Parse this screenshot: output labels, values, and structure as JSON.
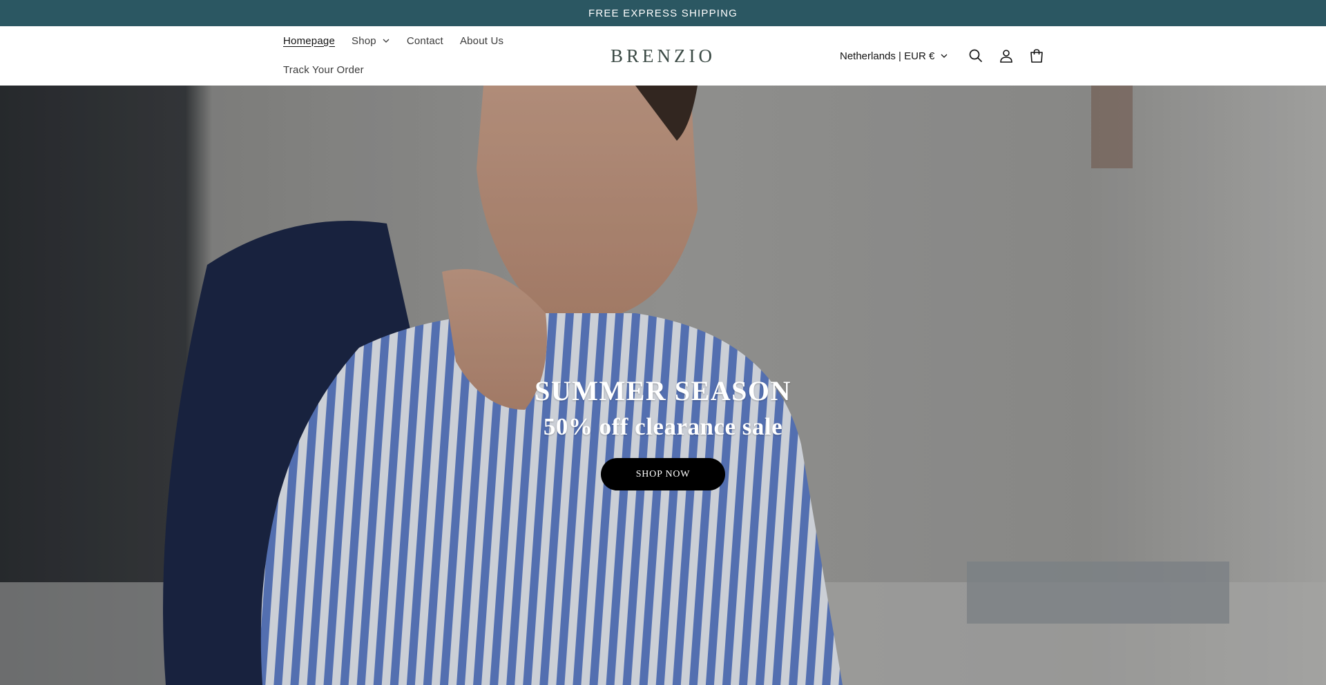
{
  "announcement": {
    "text": "FREE EXPRESS SHIPPING"
  },
  "nav": {
    "items": [
      {
        "label": "Homepage",
        "active": true
      },
      {
        "label": "Shop",
        "has_dropdown": true
      },
      {
        "label": "Contact"
      },
      {
        "label": "About Us"
      },
      {
        "label": "Track Your Order"
      }
    ]
  },
  "logo": {
    "text": "BRENZIO"
  },
  "localization": {
    "label": "Netherlands | EUR €"
  },
  "header_icons": [
    "search-icon",
    "account-icon",
    "cart-icon"
  ],
  "hero": {
    "title": "SUMMER SEASON",
    "subtitle": "50% off clearance sale",
    "button_label": "SHOP NOW"
  },
  "colors": {
    "announcement_bg": "#2b5762",
    "button_bg": "#000000",
    "logo": "#3b4a45"
  }
}
